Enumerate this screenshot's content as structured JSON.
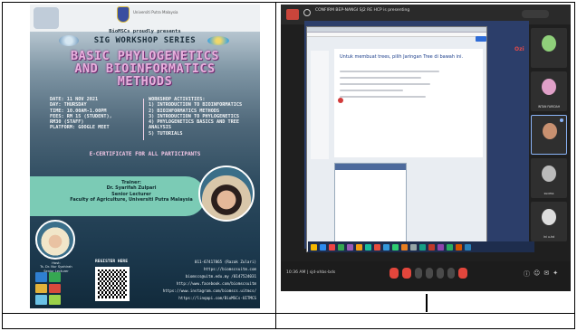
{
  "poster": {
    "org_text": "Universiti Putra Malaysia",
    "presents": "BioMSCs proudly presents",
    "series": "SIG WORKSHOP SERIES",
    "title": [
      "BASIC PHYLOGENETICS",
      "AND BIOINFORMATICS",
      "METHODS"
    ],
    "details": [
      "DATE: 11 NOV 2021",
      "DAY: THURSDAY",
      "TIME: 10.00AM-1.00PM",
      "FEES: RM 15 (STUDENT),",
      "  RM30 (STAFF)",
      "PLATFORM: GOOGLE MEET"
    ],
    "activities": [
      "WORKSHOP ACTIVITIES:",
      "1) INTRODUCTION TO BIOINFORMATICS",
      "2) BIOINFORMATICS METHODS",
      "3) INTRODUCTION TO PHYLOGENETICS",
      "4) PHYLOGENETICS BASICS AND TREE",
      "  ANALYSIS",
      "5) TUTORIALS"
    ],
    "certificate": "E-CERTIFICATE FOR ALL PARTICIPANTS",
    "trainer_label": "Trainer:",
    "trainer_name": "Dr. Syarifah Zulpari",
    "trainer_role": "Senior Lecturer",
    "trainer_affil": "Faculty of Agriculture, Universiti Putra Malaysia",
    "host_label": "Host:",
    "host_name": "Ts. Dr. Nur Syahirah",
    "host_role": "Senior Lecturer",
    "register": "REGISTER HERE",
    "contacts": [
      "011-67417865 (Razak Zulari)",
      "https://biomscsuitm.com",
      "biomscs@uitm.edu.my /0147524031",
      "http://www.facebook.com/biomscsuitm",
      "https://www.instagram.com/biomscs.uitmcs/",
      "https://linqapi.com/BioMSCs-UITMCS"
    ],
    "tile_colors": [
      "#2f7fd1",
      "#36a852",
      "#e2b23a",
      "#d84a3c",
      "#6ac2e6",
      "#9bd14a"
    ]
  },
  "meeting": {
    "banner": "CONFIRM BEP-NANGI SJ2 RE HCP is presenting",
    "brand": "Ozi",
    "page_heading": "Untuk membuat trees, pilih Jaringan Tree di bawah ini.",
    "time": "10:36 AM  |  sjd-xhbs-bds",
    "participants": [
      {
        "name": "",
        "color": "#8fd07a"
      },
      {
        "name": "INTAN FARIDAH",
        "color": "#e0a0c8"
      },
      {
        "name": "",
        "color": "#c89070"
      },
      {
        "name": "sucess",
        "color": "#bbb"
      },
      {
        "name": "lni u-hd",
        "color": "#ddd"
      }
    ],
    "taskbar_colors": [
      "#f5b700",
      "#2e8cef",
      "#e44",
      "#36a852",
      "#9b59b6",
      "#f39c12",
      "#1abc9c",
      "#e74c3c",
      "#3498db",
      "#2ecc71",
      "#e67e22",
      "#95a5a6",
      "#16a085",
      "#c0392b",
      "#8e44ad",
      "#27ae60",
      "#d35400",
      "#2980b9"
    ]
  }
}
